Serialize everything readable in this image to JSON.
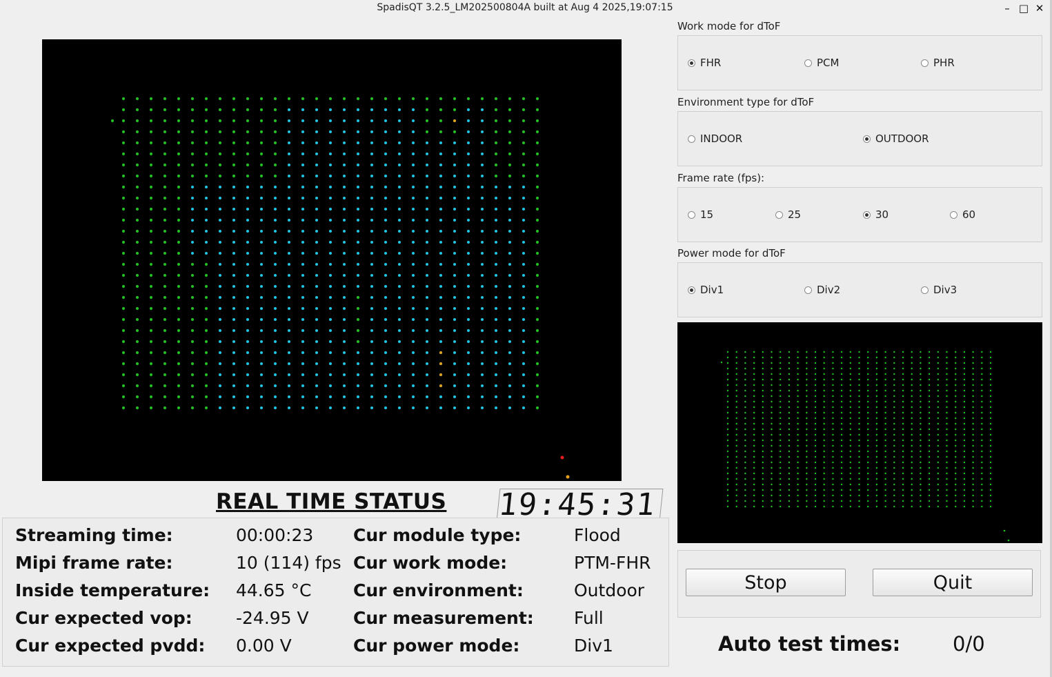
{
  "window": {
    "title": "SpadisQT 3.2.5_LM202500804A built at Aug  4 2025,19:07:15",
    "minimize_glyph": "–",
    "maximize_glyph": "□",
    "close_glyph": "✕"
  },
  "work_mode": {
    "label": "Work mode for dToF",
    "options": [
      "FHR",
      "PCM",
      "PHR"
    ],
    "selected": "FHR"
  },
  "environment": {
    "label": "Environment type for dToF",
    "options": [
      "INDOOR",
      "OUTDOOR"
    ],
    "selected": "OUTDOOR"
  },
  "frame_rate": {
    "label": "Frame rate (fps):",
    "options": [
      "15",
      "25",
      "30",
      "60"
    ],
    "selected": "30"
  },
  "power_mode": {
    "label": "Power mode for dToF",
    "options": [
      "Div1",
      "Div2",
      "Div3"
    ],
    "selected": "Div1"
  },
  "status": {
    "title": "REAL TIME STATUS",
    "clock": "19:45:31",
    "streaming_time_label": "Streaming time:",
    "streaming_time": "00:00:23",
    "mipi_frame_rate_label": "Mipi frame rate:",
    "mipi_frame_rate": "10 (114) fps",
    "inside_temperature_label": "Inside temperature:",
    "inside_temperature": "44.65 °C",
    "vop_label": "Cur expected vop:",
    "vop": "-24.95 V",
    "pvdd_label": "Cur expected pvdd:",
    "pvdd": "0.00 V",
    "module_type_label": "Cur module type:",
    "module_type": "Flood",
    "work_mode_label": "Cur work mode:",
    "work_mode": "PTM-FHR",
    "environment_label": "Cur environment:",
    "environment": "Outdoor",
    "measurement_label": "Cur measurement:",
    "measurement": "Full",
    "power_mode_label": "Cur power mode:",
    "power_mode": "Div1"
  },
  "buttons": {
    "stop": "Stop",
    "quit": "Quit"
  },
  "auto_test": {
    "label": "Auto test times:",
    "value": "0/0"
  },
  "colors": {
    "point_green": "#1ec81e",
    "point_cyan": "#1ec8e6",
    "point_orange": "#e6a01e",
    "point_red": "#e61e1e",
    "display_background": "#000000"
  }
}
